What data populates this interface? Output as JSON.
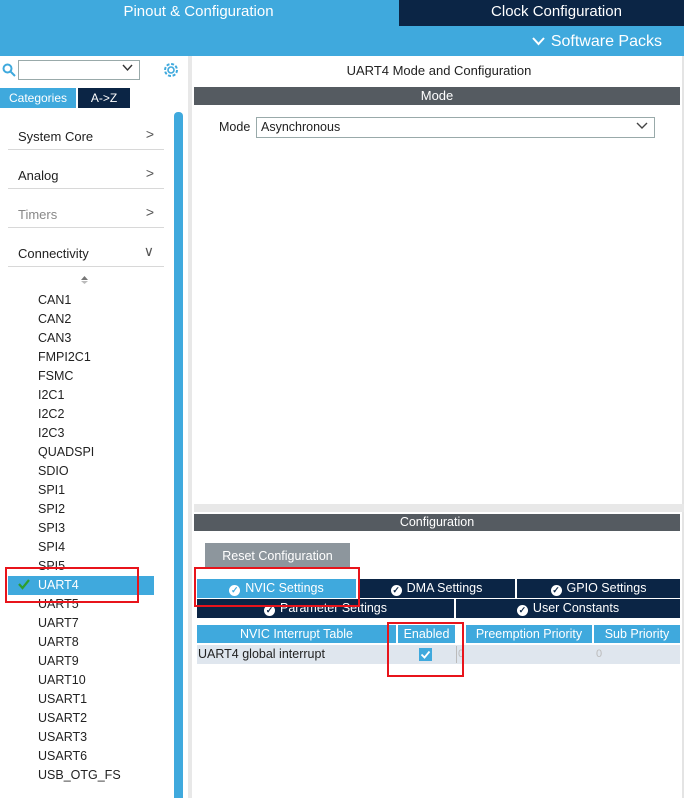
{
  "header": {
    "tab_pinout": "Pinout & Configuration",
    "tab_clock": "Clock Configuration",
    "software_packs": "Software Packs",
    "chevron": "∨"
  },
  "colors": {
    "accent": "#3fa9dd",
    "dark_tab": "#0b2545",
    "section_header": "#555b61",
    "highlight": "#e8141b"
  },
  "sidebar": {
    "search_value": "",
    "tabs": {
      "categories": "Categories",
      "az": "A->Z"
    },
    "categories": [
      {
        "label": "System Core",
        "chevron": ">"
      },
      {
        "label": "Analog",
        "chevron": ">"
      },
      {
        "label": "Timers",
        "chevron": ">"
      },
      {
        "label": "Connectivity",
        "chevron": "∨"
      }
    ],
    "peripherals": [
      "CAN1",
      "CAN2",
      "CAN3",
      "FMPI2C1",
      "FSMC",
      "I2C1",
      "I2C2",
      "I2C3",
      "QUADSPI",
      "SDIO",
      "SPI1",
      "SPI2",
      "SPI3",
      "SPI4",
      "SPI5",
      "UART4",
      "UART5",
      "UART7",
      "UART8",
      "UART9",
      "UART10",
      "USART1",
      "USART2",
      "USART3",
      "USART6",
      "USB_OTG_FS"
    ],
    "selected": "UART4"
  },
  "mode": {
    "title": "UART4 Mode and Configuration",
    "header": "Mode",
    "label": "Mode",
    "value": "Asynchronous"
  },
  "config": {
    "header": "Configuration",
    "reset_button": "Reset Configuration",
    "tabs": {
      "nvic": "NVIC Settings",
      "dma": "DMA Settings",
      "gpio": "GPIO Settings",
      "param": "Parameter Settings",
      "user": "User Constants"
    },
    "table": {
      "headers": [
        "NVIC Interrupt Table",
        "Enabled",
        "Preemption Priority",
        "Sub Priority"
      ],
      "rows": [
        {
          "name": "UART4 global interrupt",
          "enabled": true,
          "preemption": "0",
          "sub": "0"
        }
      ]
    }
  }
}
